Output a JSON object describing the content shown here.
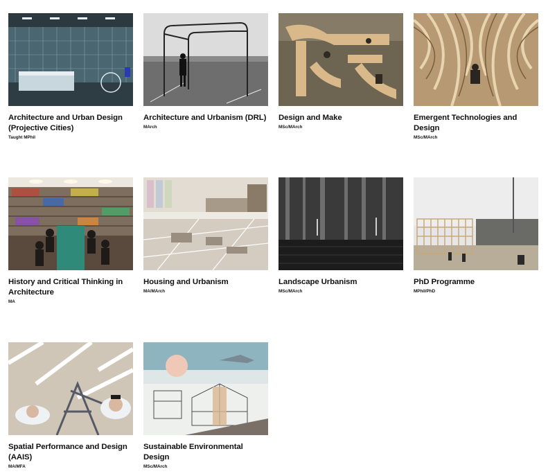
{
  "programmes": [
    {
      "title": "Architecture and Urban Design (Projective Cities)",
      "degree": "Taught MPhil",
      "image_icon": "interior-render-image"
    },
    {
      "title": "Architecture and Urbanism (DRL)",
      "degree": "MArch",
      "image_icon": "pavilion-frame-photo"
    },
    {
      "title": "Design and Make",
      "degree": "MSc/MArch",
      "image_icon": "timber-joinery-photo"
    },
    {
      "title": "Emergent Technologies and Design",
      "degree": "MSc/MArch",
      "image_icon": "timber-structure-photo"
    },
    {
      "title": "History and Critical Thinking in Architecture",
      "degree": "MA",
      "image_icon": "library-seminar-photo"
    },
    {
      "title": "Housing and Urbanism",
      "degree": "MA/MArch",
      "image_icon": "collage-drawing-image"
    },
    {
      "title": "Landscape Urbanism",
      "degree": "MSc/MArch",
      "image_icon": "forest-night-image"
    },
    {
      "title": "PhD Programme",
      "degree": "MPhil/PhD",
      "image_icon": "timber-frame-site-photo"
    },
    {
      "title": "Spatial Performance and Design (AAIS)",
      "degree": "MA/MFA",
      "image_icon": "performance-costume-photo"
    },
    {
      "title": "Sustainable Environmental Design",
      "degree": "MSc/MArch",
      "image_icon": "section-drawing-image"
    }
  ]
}
